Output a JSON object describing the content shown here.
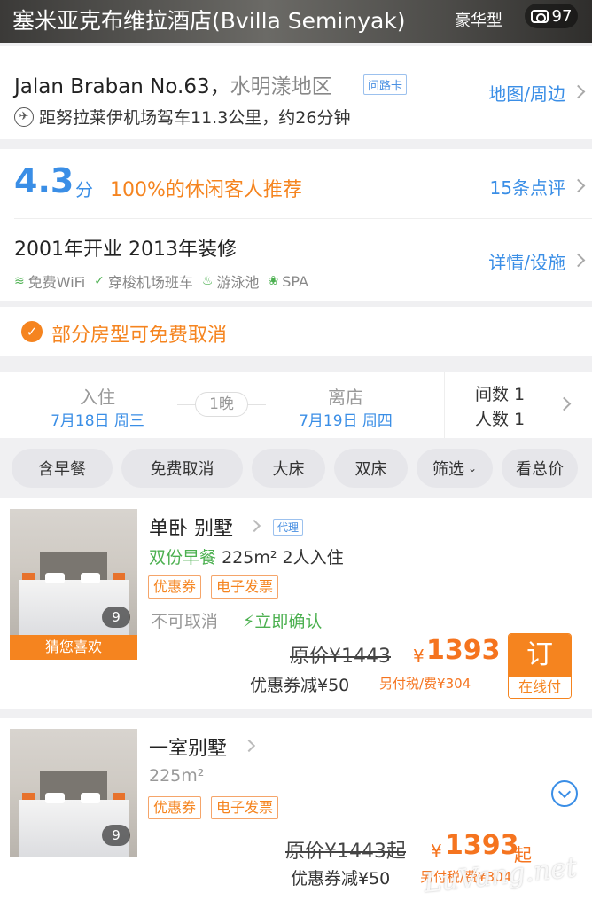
{
  "header": {
    "title": "塞米亚克布维拉酒店(Bvilla Seminyak)",
    "room_tag": "豪华型",
    "photo_count": "97"
  },
  "address": {
    "street": "Jalan Braban No.63，",
    "district": "水明漾地区",
    "route_card": "问路卡",
    "airport_distance": "距努拉莱伊机场驾车11.3公里，约26分钟",
    "map_link": "地图/周边"
  },
  "rating": {
    "score": "4.3",
    "unit": "分",
    "recommend": "100%的休闲客人推荐",
    "reviews_link": "15条点评",
    "open_info": "2001年开业 2013年装修",
    "details_link": "详情/设施",
    "facilities": [
      {
        "icon": "wifi-icon",
        "label": "免费WiFi"
      },
      {
        "icon": "shuttle-check-icon",
        "label": "穿梭机场班车"
      },
      {
        "icon": "pool-icon",
        "label": "游泳池"
      },
      {
        "icon": "spa-icon",
        "label": "SPA"
      }
    ]
  },
  "cancel_notice": "部分房型可免费取消",
  "booking": {
    "checkin_label": "入住",
    "checkin_date": "7月18日 周三",
    "nights": "1晚",
    "checkout_label": "离店",
    "checkout_date": "7月19日 周四",
    "rooms": "间数 1",
    "guests": "人数 1"
  },
  "filters": [
    "含早餐",
    "免费取消",
    "大床",
    "双床",
    "筛选",
    "看总价"
  ],
  "rooms": [
    {
      "name": "单卧 别墅",
      "agent_tag": "代理",
      "breakfast": "双份早餐",
      "area": "225m²",
      "occupancy": "2人入住",
      "badges": [
        "优惠券",
        "电子发票"
      ],
      "cancel": "不可取消",
      "confirm": "立即确认",
      "original_price": "原价¥1443",
      "currency": "¥",
      "price": "1393",
      "coupon": "优惠券减¥50",
      "tax": "另付税/费¥304",
      "image_count": "9",
      "guess_label": "猜您喜欢",
      "book_label": "订",
      "pay_label": "在线付"
    },
    {
      "name": "一室别墅",
      "area": "225m²",
      "badges": [
        "优惠券",
        "电子发票"
      ],
      "original_price": "原价¥1443起",
      "currency": "¥",
      "price": "1393",
      "price_suffix": "起",
      "coupon": "优惠券减¥50",
      "tax": "另付税/费¥304",
      "image_count": "9"
    }
  ],
  "watermark": "LuVang.net",
  "colors": {
    "accent_blue": "#3a8ee6",
    "accent_orange": "#f5841f",
    "green": "#4cb050"
  }
}
